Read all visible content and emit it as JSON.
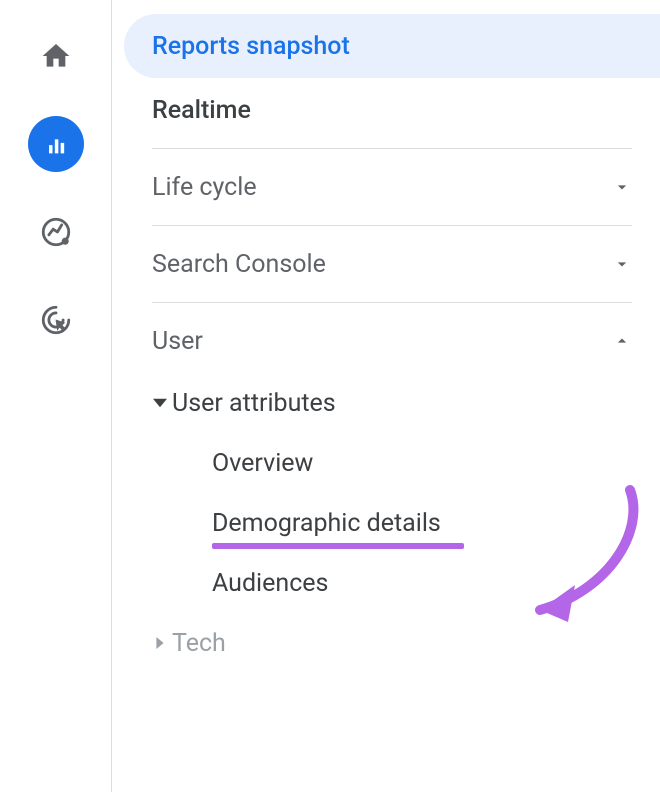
{
  "rail": {
    "items": [
      "home",
      "reports",
      "explore",
      "target"
    ],
    "activeIndex": 1
  },
  "nav": {
    "reportsSnapshot": "Reports snapshot",
    "realtime": "Realtime",
    "lifeCycle": "Life cycle",
    "searchConsole": "Search Console",
    "user": "User",
    "userAttributes": "User attributes",
    "overview": "Overview",
    "demographicDetails": "Demographic details",
    "audiences": "Audiences",
    "tech": "Tech"
  },
  "annotation": {
    "highlightColor": "#b366e8"
  }
}
